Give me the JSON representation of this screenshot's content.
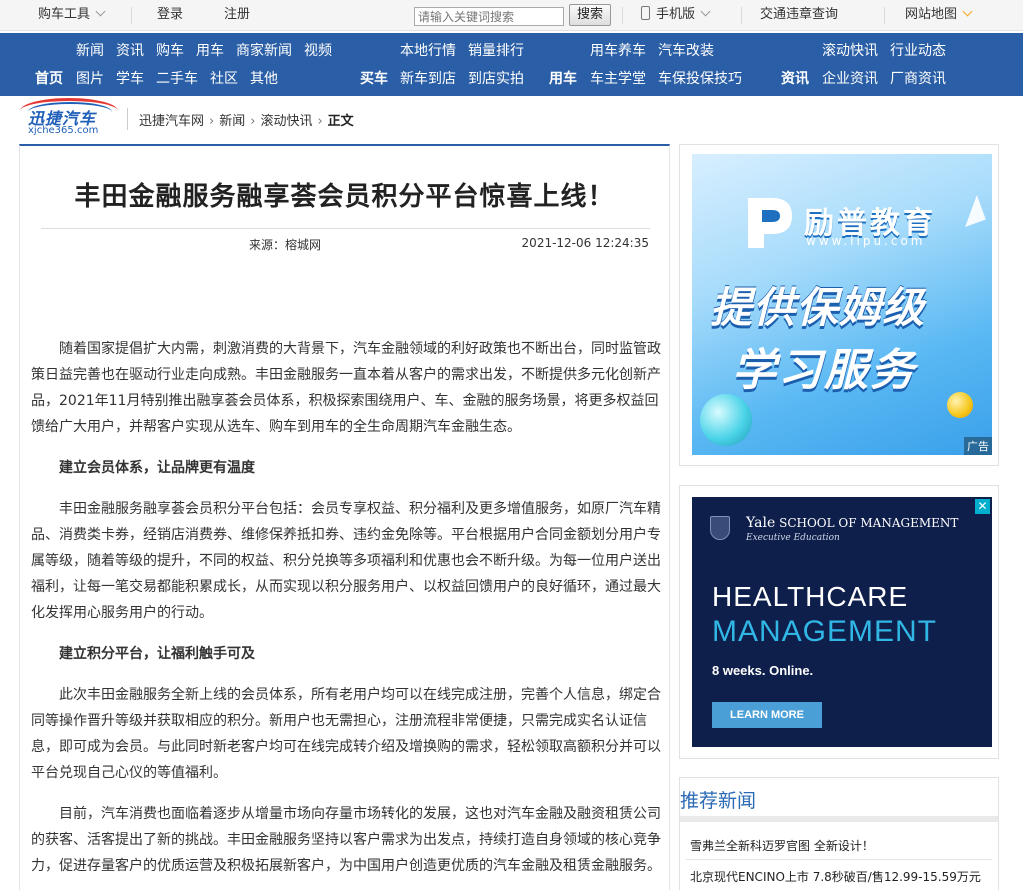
{
  "topbar": {
    "car_tools": "购车工具",
    "login": "登录",
    "register": "注册",
    "search_placeholder": "请输入关键词搜索",
    "search_button": "搜索",
    "mobile": "手机版",
    "traffic_query": "交通违章查询",
    "sitemap": "网站地图"
  },
  "nav": {
    "group1_row1": [
      "新闻",
      "资讯",
      "购车",
      "用车",
      "商家新闻",
      "视频"
    ],
    "group1_row2": [
      "首页",
      "图片",
      "学车",
      "二手车",
      "社区",
      "其他"
    ],
    "group2_row1": [
      "本地行情",
      "销量排行"
    ],
    "group2_row2": [
      "买车",
      "新车到店",
      "到店实拍"
    ],
    "group3_row1": [
      "用车养车",
      "汽车改装"
    ],
    "group3_row2": [
      "用车",
      "车主学堂",
      "车保投保技巧"
    ],
    "group4_row1": [
      "滚动快讯",
      "行业动态"
    ],
    "group4_row2": [
      "资讯",
      "企业资讯",
      "厂商资讯"
    ]
  },
  "logo": {
    "name": "迅捷汽车",
    "domain": "xjche365.com"
  },
  "breadcrumb": [
    "迅捷汽车网",
    "新闻",
    "滚动快讯",
    "正文"
  ],
  "article": {
    "title": "丰田金融服务融享荟会员积分平台惊喜上线！",
    "source": "来源：榕城网",
    "date": "2021-12-06 12:24:35",
    "paragraphs": [
      {
        "type": "text",
        "text": "随着国家提倡扩大内需，刺激消费的大背景下，汽车金融领域的利好政策也不断出台，同时监管政策日益完善也在驱动行业走向成熟。丰田金融服务一直本着从客户的需求出发，不断提供多元化创新产品，2021年11月特别推出融享荟会员体系，积极探索围绕用户、车、金融的服务场景，将更多权益回馈给广大用户，并帮客户实现从选车、购车到用车的全生命周期汽车金融生态。"
      },
      {
        "type": "heading",
        "text": "建立会员体系，让品牌更有温度"
      },
      {
        "type": "text",
        "text": "丰田金融服务融享荟会员积分平台包括：会员专享权益、积分福利及更多增值服务，如原厂汽车精品、消费类卡券，经销店消费券、维修保养抵扣券、违约金免除等。平台根据用户合同金额划分用户专属等级，随着等级的提升，不同的权益、积分兑换等多项福利和优惠也会不断升级。为每一位用户送出福利，让每一笔交易都能积累成长，从而实现以积分服务用户、以权益回馈用户的良好循环，通过最大化发挥用心服务用户的行动。"
      },
      {
        "type": "heading",
        "text": "建立积分平台，让福利触手可及"
      },
      {
        "type": "text",
        "text": "此次丰田金融服务全新上线的会员体系，所有老用户均可以在线完成注册，完善个人信息，绑定合同等操作晋升等级并获取相应的积分。新用户也无需担心，注册流程非常便捷，只需完成实名认证信息，即可成为会员。与此同时新老客户均可在线完成转介绍及增换购的需求，轻松领取高额积分并可以平台兑现自己心仪的等值福利。"
      },
      {
        "type": "text",
        "text": "目前，汽车消费也面临着逐步从增量市场向存量市场转化的发展，这也对汽车金融及融资租赁公司的获客、活客提出了新的挑战。丰田金融服务坚持以客户需求为出发点，持续打造自身领域的核心竞争力，促进存量客户的优质运营及积极拓展新客户，为中国用户创造更优质的汽车金融及租赁金融服务。"
      }
    ]
  },
  "ad1": {
    "brand": "励普教育",
    "url": "www.lipu.com",
    "line1": "提供保姆级",
    "line2": "学习服务",
    "tag": "广告"
  },
  "ad2": {
    "close": "✕",
    "school": "SCHOOL OF MANAGEMENT",
    "yale": "Yale",
    "exec": "Executive Education",
    "headline1": "HEALTHCARE",
    "headline2": "MANAGEMENT",
    "weeks": "8 weeks. Online.",
    "cta": "LEARN MORE"
  },
  "recommend": {
    "title": "推荐新闻",
    "items": [
      "雪弗兰全新科迈罗官图 全新设计！",
      "北京现代ENCINO上市 7.8秒破百/售12.99-15.59万元"
    ]
  },
  "colors": {
    "nav_bg": "#2a5ea6",
    "link_blue": "#2a6ab4",
    "ad2_bg": "#0f1f4b",
    "ad2_accent": "#31b7e6"
  }
}
